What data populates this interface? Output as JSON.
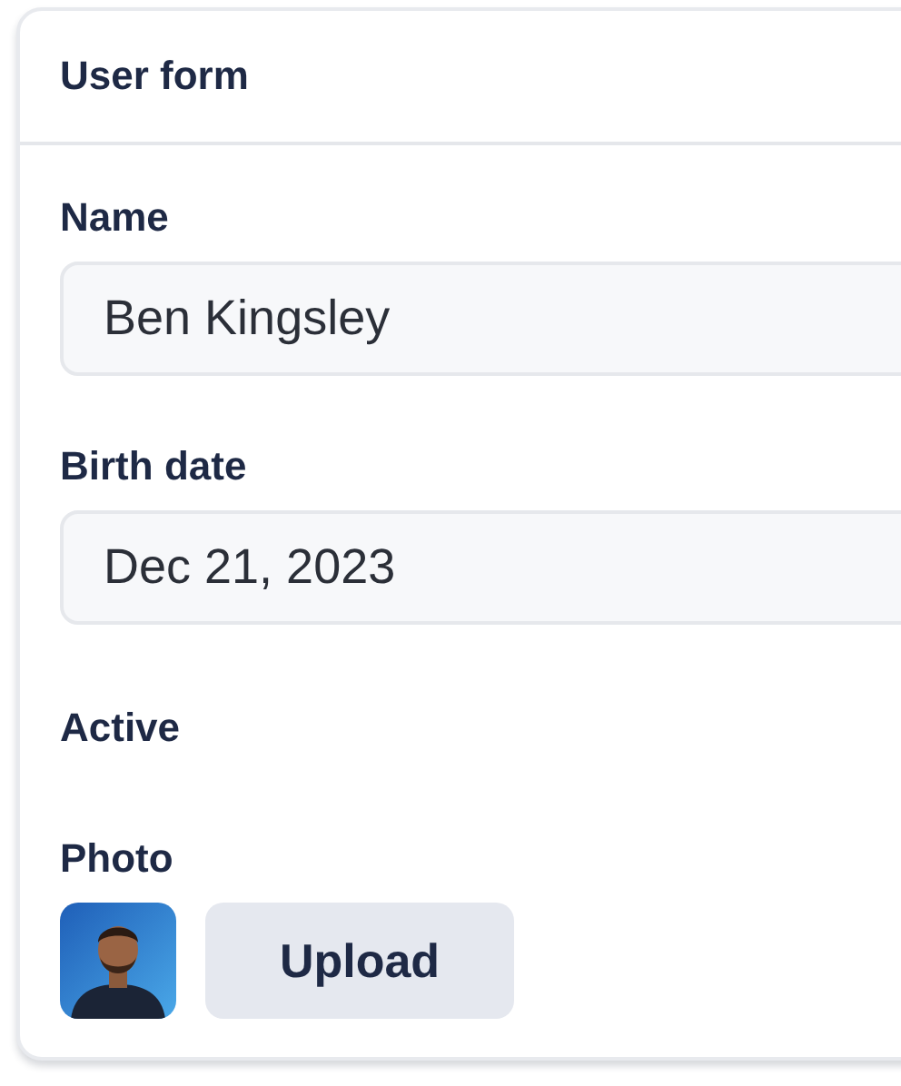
{
  "card": {
    "title": "User form",
    "fields": [
      {
        "kind": "text",
        "label": "Name",
        "value": "Ben Kingsley"
      },
      {
        "kind": "text",
        "label": "Birth date",
        "value": "Dec 21, 2023"
      },
      {
        "kind": "label",
        "label": "Active"
      },
      {
        "label": "Photo",
        "button": "Upload"
      }
    ]
  }
}
